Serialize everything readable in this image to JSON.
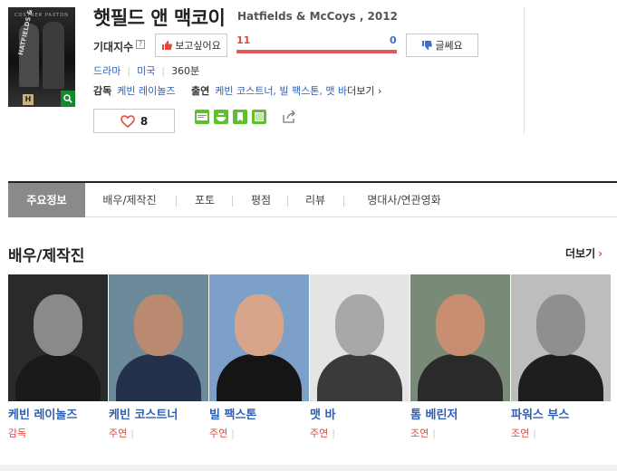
{
  "poster": {
    "top_text": "COSTNER PAXTON",
    "title_text": "HATFIELDS & McCOYS",
    "channel_badge": "H"
  },
  "movie": {
    "title_ko": "햇필드 앤 맥코이",
    "title_en": "Hatfields & McCoys , 2012"
  },
  "expect": {
    "label": "기대지수",
    "help": "?",
    "want_label": "보고싶어요",
    "want_count": "11",
    "nowant_count": "0",
    "nowant_label": "글쎄요"
  },
  "meta": {
    "genre": "드라마",
    "country": "미국",
    "runtime": "360분"
  },
  "credits": {
    "director_label": "감독",
    "director": "케빈 레이놀즈",
    "cast_label": "출연",
    "cast": "케빈 코스트너, 빌 팩스톤, 맷 바",
    "more": "더보기"
  },
  "like": {
    "count": "8"
  },
  "share_icons": [
    "blog-icon",
    "me2day-icon",
    "bookmark-icon",
    "yozm-icon",
    "share-icon"
  ],
  "tabs": [
    {
      "label": "주요정보",
      "active": true
    },
    {
      "label": "배우/제작진"
    },
    {
      "label": "포토"
    },
    {
      "label": "평점"
    },
    {
      "label": "리뷰"
    },
    {
      "label": "명대사/연관영화"
    }
  ],
  "section": {
    "title": "배우/제작진",
    "more": "더보기"
  },
  "cast_list": [
    {
      "name": "케빈 레이놀즈",
      "role": "감독",
      "divider": false
    },
    {
      "name": "케빈 코스트너",
      "role": "주연",
      "divider": true
    },
    {
      "name": "빌 팩스톤",
      "role": "주연",
      "divider": true
    },
    {
      "name": "맷 바",
      "role": "주연",
      "divider": true
    },
    {
      "name": "톰 베린저",
      "role": "조연",
      "divider": true
    },
    {
      "name": "파워스 부스",
      "role": "조연",
      "divider": true
    }
  ],
  "colors": {
    "accent_red": "#e1483e",
    "link_blue": "#2e5fb5",
    "tab_active": "#8a8a8a",
    "zoom_green": "#148a2e"
  }
}
